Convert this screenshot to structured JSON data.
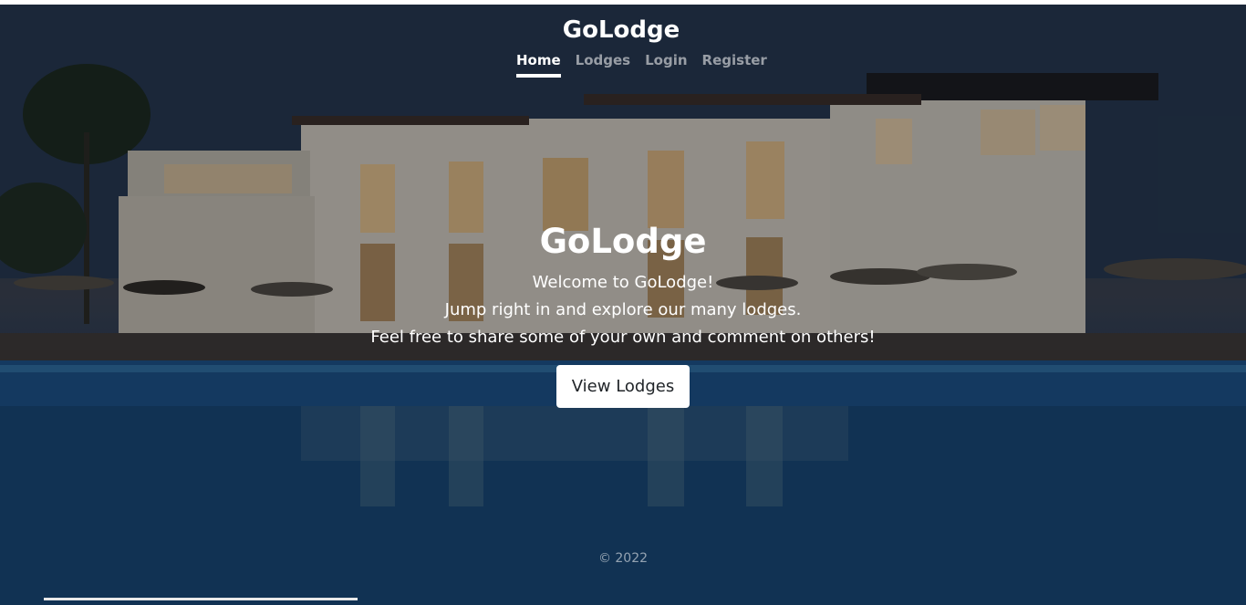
{
  "header": {
    "brand": "GoLodge",
    "nav": [
      {
        "label": "Home",
        "active": true
      },
      {
        "label": "Lodges",
        "active": false
      },
      {
        "label": "Login",
        "active": false
      },
      {
        "label": "Register",
        "active": false
      }
    ]
  },
  "main": {
    "title": "GoLodge",
    "lines": [
      "Welcome to GoLodge!",
      "Jump right in and explore our many lodges.",
      "Feel free to share some of your own and comment on others!"
    ],
    "button_label": "View Lodges"
  },
  "footer": {
    "copyright": "© 2022"
  },
  "colors": {
    "text": "#ffffff",
    "muted_text": "rgba(255,255,255,0.55)",
    "button_bg": "#ffffff",
    "button_text": "#212529"
  }
}
